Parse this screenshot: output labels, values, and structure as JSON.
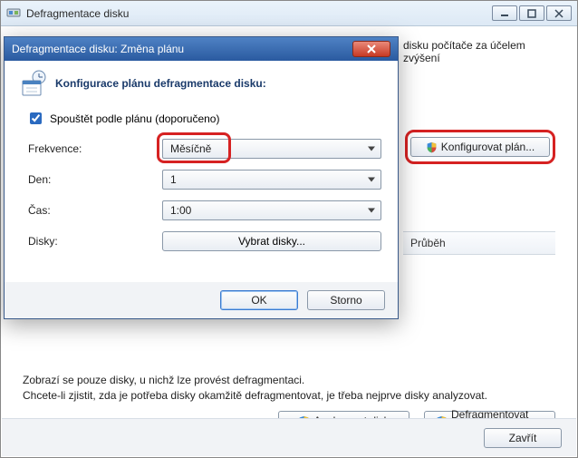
{
  "main": {
    "title": "Defragmentace disku",
    "description_tail": "disku počítače za účelem zvýšení",
    "config_button": "Konfigurovat plán...",
    "table_col_progress": "Průběh",
    "note_line1": "Zobrazí se pouze disky, u nichž lze provést defragmentaci.",
    "note_line2": "Chcete-li zjistit, zda je potřeba disky okamžitě defragmentovat, je třeba nejprve disky analyzovat.",
    "analyze_btn": "Analyzovat disk",
    "defrag_btn": "Defragmentovat disk",
    "close_btn": "Zavřít"
  },
  "modal": {
    "title": "Defragmentace disku: Změna plánu",
    "heading": "Konfigurace plánu defragmentace disku:",
    "checkbox_label": "Spouštět podle plánu (doporučeno)",
    "checkbox_checked": true,
    "labels": {
      "freq": "Frekvence:",
      "day": "Den:",
      "time": "Čas:",
      "disks": "Disky:"
    },
    "values": {
      "freq": "Měsíčně",
      "day": "1",
      "time": "1:00"
    },
    "select_disks_btn": "Vybrat disky...",
    "ok": "OK",
    "cancel": "Storno"
  }
}
